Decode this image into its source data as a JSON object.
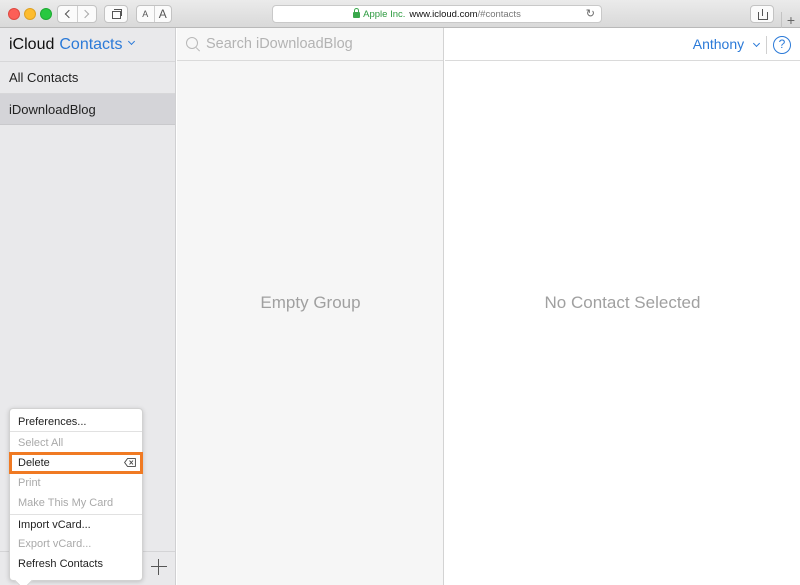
{
  "browser": {
    "url_org": "Apple Inc.",
    "url_host": "www.icloud.com",
    "url_path": "/#contacts",
    "font_small": "A",
    "font_large": "A",
    "reload_glyph": "↻",
    "new_tab_glyph": "+"
  },
  "app": {
    "brand": "iCloud",
    "section": "Contacts"
  },
  "sidebar": {
    "items": [
      {
        "label": "All Contacts"
      },
      {
        "label": "iDownloadBlog"
      }
    ]
  },
  "search": {
    "placeholder": "Search iDownloadBlog"
  },
  "middle": {
    "empty_message": "Empty Group"
  },
  "detail": {
    "user_name": "Anthony",
    "help_glyph": "?",
    "no_contact_message": "No Contact Selected"
  },
  "menu": {
    "items": [
      {
        "label": "Preferences..."
      },
      {
        "label": "Select All"
      },
      {
        "label": "Delete"
      },
      {
        "label": "Print"
      },
      {
        "label": "Make This My Card"
      },
      {
        "label": "Import vCard..."
      },
      {
        "label": "Export vCard..."
      },
      {
        "label": "Refresh Contacts"
      }
    ]
  },
  "colors": {
    "accent": "#2b7ad8",
    "highlight": "#f07a23",
    "sidebar_bg": "#e9e9eb"
  }
}
